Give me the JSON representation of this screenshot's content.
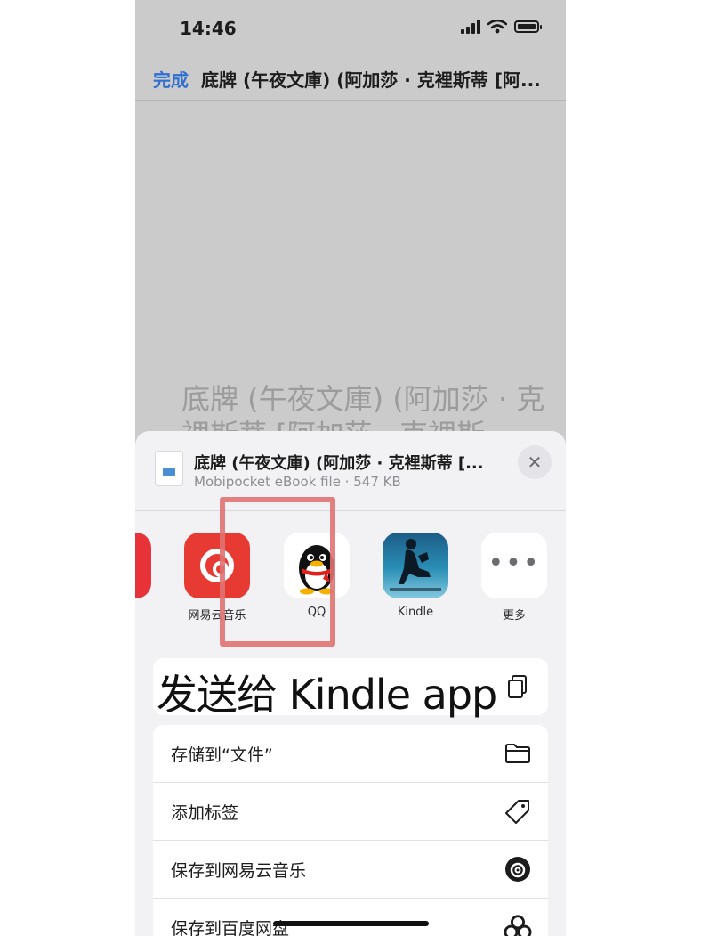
{
  "status": {
    "time": "14:46"
  },
  "navbar": {
    "done_label": "完成",
    "title": "底牌 (午夜文庫) (阿加莎 · 克裡斯蒂 [阿..."
  },
  "background": {
    "title": "底牌 (午夜文庫) (阿加莎 · 克裡斯蒂 [阿加莎 · 克裡斯"
  },
  "share_sheet": {
    "file_name": "底牌 (午夜文庫) (阿加莎 · 克裡斯蒂 [...",
    "file_meta": "Mobipocket eBook file · 547 KB",
    "close_glyph": "✕",
    "apps": [
      {
        "label": "网易云音乐",
        "icon": "netease-music-icon",
        "color": "#e63a32"
      },
      {
        "label": "QQ",
        "icon": "qq-penguin-icon"
      },
      {
        "label": "Kindle",
        "icon": "kindle-reader-icon"
      },
      {
        "label": "更多",
        "icon": "more-dots-icon",
        "glyph": "•••"
      }
    ],
    "actions": [
      {
        "label": "存储到“文件”",
        "icon": "folder-icon"
      },
      {
        "label": "添加标签",
        "icon": "tag-icon"
      },
      {
        "label": "保存到网易云音乐",
        "icon": "netease-music-icon"
      },
      {
        "label": "保存到百度网盘",
        "icon": "baidu-netdisk-icon"
      }
    ]
  },
  "annotation": {
    "caption": "发送给 Kindle app",
    "highlight_color": "#e07272"
  }
}
